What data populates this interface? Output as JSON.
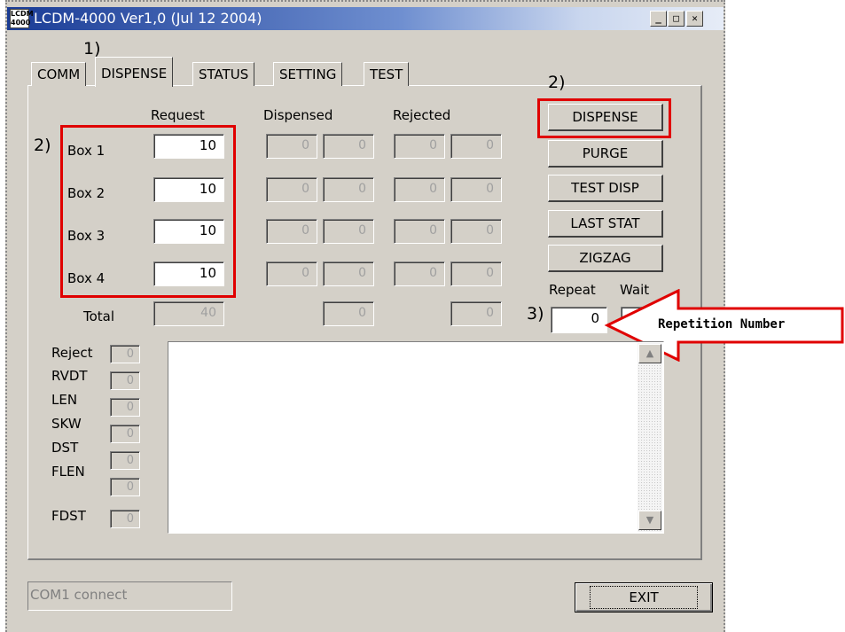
{
  "window": {
    "title": "LCDM-4000 Ver1,0 (Jul 12 2004)",
    "icon_text": "LCDM 4000",
    "controls": {
      "minimize": "_",
      "maximize": "□",
      "close": "✕"
    }
  },
  "tabs": [
    {
      "label": "COMM"
    },
    {
      "label": "DISPENSE"
    },
    {
      "label": "STATUS"
    },
    {
      "label": "SETTING"
    },
    {
      "label": "TEST"
    }
  ],
  "headers": {
    "request": "Request",
    "dispensed": "Dispensed",
    "rejected": "Rejected"
  },
  "boxes": [
    {
      "label": "Box 1",
      "request": "10",
      "dispensed": [
        "0",
        "0"
      ],
      "rejected": [
        "0",
        "0"
      ]
    },
    {
      "label": "Box 2",
      "request": "10",
      "dispensed": [
        "0",
        "0"
      ],
      "rejected": [
        "0",
        "0"
      ]
    },
    {
      "label": "Box 3",
      "request": "10",
      "dispensed": [
        "0",
        "0"
      ],
      "rejected": [
        "0",
        "0"
      ]
    },
    {
      "label": "Box 4",
      "request": "10",
      "dispensed": [
        "0",
        "0"
      ],
      "rejected": [
        "0",
        "0"
      ]
    }
  ],
  "total": {
    "label": "Total",
    "request": "40",
    "dispensed": "0",
    "rejected": "0"
  },
  "buttons": {
    "dispense": "DISPENSE",
    "purge": "PURGE",
    "test_disp": "TEST DISP",
    "last_stat": "LAST STAT",
    "zigzag": "ZIGZAG",
    "exit": "EXIT"
  },
  "repeat": {
    "label": "Repeat",
    "value": "0"
  },
  "wait": {
    "label": "Wait"
  },
  "stats": [
    {
      "label": "Reject",
      "value": "0"
    },
    {
      "label": "RVDT",
      "value": "0"
    },
    {
      "label": "LEN",
      "value": "0"
    },
    {
      "label": "SKW",
      "value": "0"
    },
    {
      "label": "DST",
      "value": "0"
    },
    {
      "label": "FLEN",
      "value": "0"
    },
    {
      "label": "FDST",
      "value": "0"
    }
  ],
  "status": "COM1 connect",
  "annotations": {
    "tab_marker": "1)",
    "fields_marker": "2)",
    "button_marker": "2)",
    "repeat_marker": "3)",
    "arrow_label": "Repetition Number"
  },
  "colors": {
    "highlight": "#e00000",
    "title_bar": "#1a3c96",
    "face": "#d4d0c8"
  }
}
